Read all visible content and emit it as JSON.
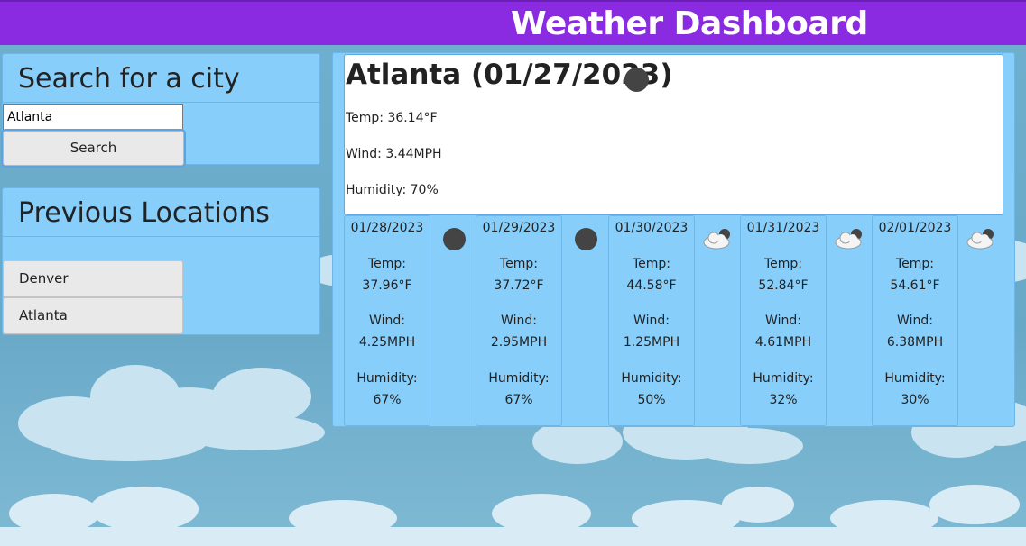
{
  "header": {
    "title": "Weather Dashboard"
  },
  "search": {
    "heading": "Search for a city",
    "input_value": "Atlanta",
    "button_label": "Search"
  },
  "history": {
    "heading": "Previous Locations",
    "items": [
      {
        "label": "Denver"
      },
      {
        "label": "Atlanta"
      }
    ]
  },
  "current": {
    "title": "Atlanta (01/27/2023)",
    "icon": "moon-icon",
    "temp": "Temp: 36.14°F",
    "wind": "Wind: 3.44MPH",
    "humidity": "Humidity: 70%"
  },
  "forecast": [
    {
      "date": "01/28/2023",
      "icon": "moon-icon",
      "temp_label": "Temp:",
      "temp": "37.96°F",
      "wind_label": "Wind:",
      "wind": "4.25MPH",
      "humidity_label": "Humidity:",
      "humidity": "67%"
    },
    {
      "date": "01/29/2023",
      "icon": "moon-icon",
      "temp_label": "Temp:",
      "temp": "37.72°F",
      "wind_label": "Wind:",
      "wind": "2.95MPH",
      "humidity_label": "Humidity:",
      "humidity": "67%"
    },
    {
      "date": "01/30/2023",
      "icon": "cloud-icon",
      "temp_label": "Temp:",
      "temp": "44.58°F",
      "wind_label": "Wind:",
      "wind": "1.25MPH",
      "humidity_label": "Humidity:",
      "humidity": "50%"
    },
    {
      "date": "01/31/2023",
      "icon": "cloud-icon",
      "temp_label": "Temp:",
      "temp": "52.84°F",
      "wind_label": "Wind:",
      "wind": "4.61MPH",
      "humidity_label": "Humidity:",
      "humidity": "32%"
    },
    {
      "date": "02/01/2023",
      "icon": "cloud-icon",
      "temp_label": "Temp:",
      "temp": "54.61°F",
      "wind_label": "Wind:",
      "wind": "6.38MPH",
      "humidity_label": "Humidity:",
      "humidity": "30%"
    }
  ],
  "colors": {
    "header": "#8a2be2",
    "panel": "#87cefa",
    "background": "#6fb0cf"
  }
}
